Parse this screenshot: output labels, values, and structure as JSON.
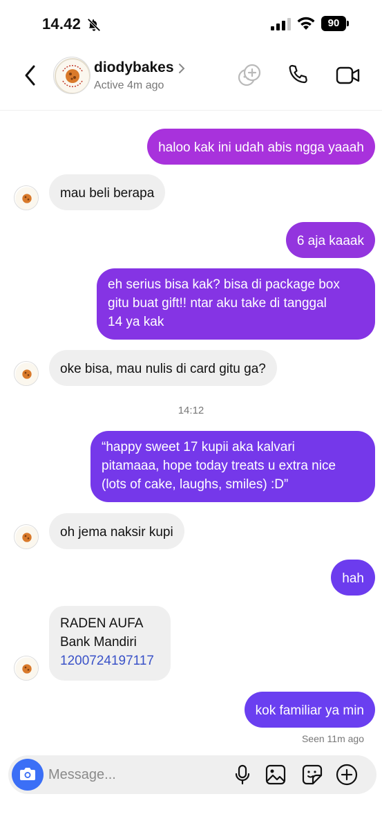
{
  "status_bar": {
    "time": "14.42",
    "battery": "90"
  },
  "header": {
    "name": "diodybakes",
    "status": "Active 4m ago",
    "avatar_text": "DIODY BAKE"
  },
  "messages": [
    {
      "from": "me",
      "text": "haloo kak ini udah abis ngga yaaah"
    },
    {
      "from": "them",
      "text": "mau beli berapa"
    },
    {
      "from": "me",
      "text": "6 aja kaaak"
    },
    {
      "from": "me",
      "lines": [
        "eh serius bisa kak? bisa di package box",
        "gitu buat gift!! ntar aku take di tanggal",
        "14 ya kak"
      ]
    },
    {
      "from": "them",
      "text": "oke bisa, mau nulis di card gitu ga?"
    },
    {
      "type": "timestamp",
      "text": "14:12"
    },
    {
      "from": "me",
      "lines": [
        "“happy sweet 17 kupii aka kalvari",
        "pitamaaa, hope today treats u extra nice",
        "(lots of cake, laughs, smiles) :D”"
      ]
    },
    {
      "from": "them",
      "text": "oh jema naksir kupi"
    },
    {
      "from": "me",
      "text": "hah"
    },
    {
      "from": "them",
      "lines": [
        "RADEN AUFA",
        "Bank Mandiri"
      ],
      "link": "1200724197117"
    },
    {
      "from": "me",
      "text": "kok familiar ya min"
    }
  ],
  "seen": "Seen 11m ago",
  "input": {
    "placeholder": "Message..."
  },
  "colors": {
    "bubble_magenta": "#a832dc",
    "bubble_violet": "#7b36ec",
    "bubble_indigo": "#6a3ff0",
    "camera_blue": "#3b6ff6",
    "incoming_bg": "#efefef",
    "link_blue": "#3a52c8"
  },
  "icons": [
    "bell-slash-icon",
    "signal-icon",
    "wifi-icon",
    "back-arrow-icon",
    "chevron-right-icon",
    "add-people-icon",
    "phone-icon",
    "video-camera-icon",
    "camera-icon",
    "microphone-icon",
    "gallery-icon",
    "sticker-icon",
    "plus-icon"
  ]
}
